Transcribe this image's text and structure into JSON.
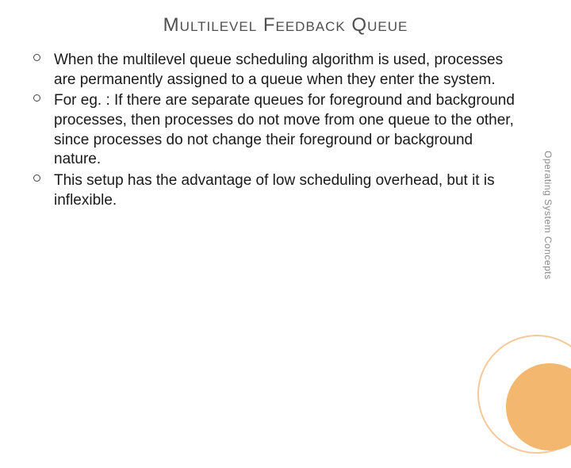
{
  "title": "Multilevel  Feedback Queue",
  "bullets": [
    "When the multilevel queue scheduling algorithm is used, processes are permanently assigned to a queue when they enter the system.",
    "For eg. : If there are separate queues for foreground and background processes, then processes do not move from one queue to the other, since processes do not change their foreground or background nature.",
    "This setup has the advantage of low scheduling overhead, but it is inflexible."
  ],
  "side_label": "Operating System Concepts"
}
